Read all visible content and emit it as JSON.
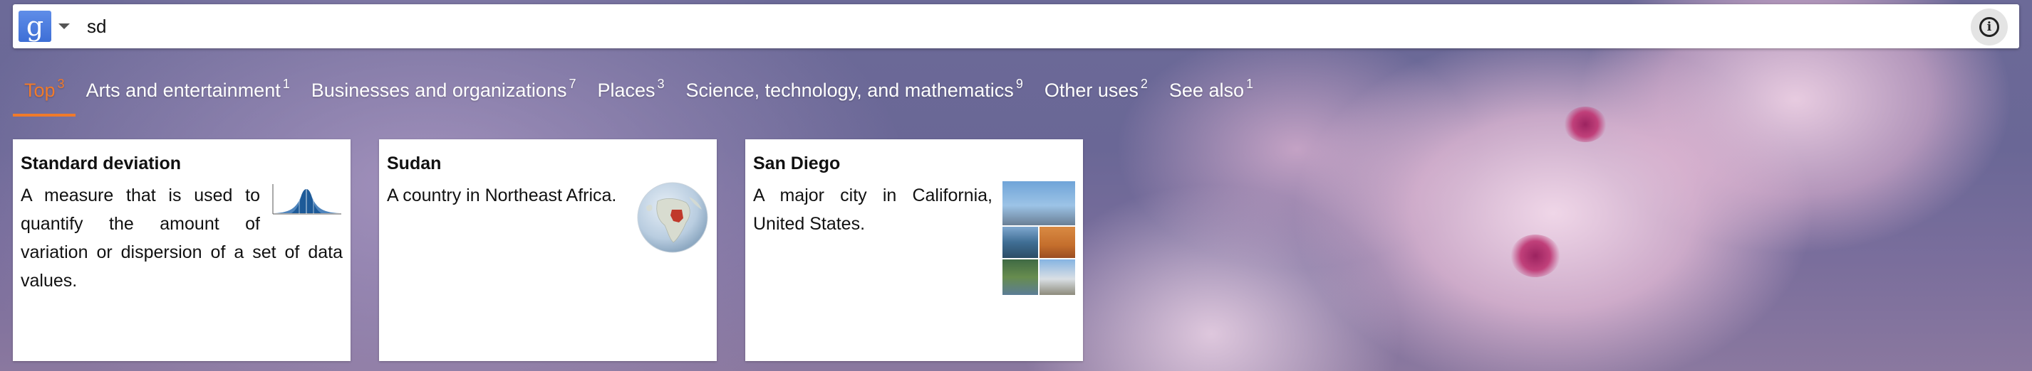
{
  "search": {
    "engine_icon": "google-g-icon",
    "engine_letter": "g",
    "query": "sd",
    "info_icon": "info-icon"
  },
  "tabs": [
    {
      "label": "Top",
      "count": "3",
      "active": true
    },
    {
      "label": "Arts and entertainment",
      "count": "1",
      "active": false
    },
    {
      "label": "Businesses and organizations",
      "count": "7",
      "active": false
    },
    {
      "label": "Places",
      "count": "3",
      "active": false
    },
    {
      "label": "Science, technology, and mathematics",
      "count": "9",
      "active": false
    },
    {
      "label": "Other uses",
      "count": "2",
      "active": false
    },
    {
      "label": "See also",
      "count": "1",
      "active": false
    }
  ],
  "cards": [
    {
      "title": "Standard deviation",
      "description": "A measure that is used to quantify the amount of variation or dispersion of a set of data values.",
      "thumbnail": "normal-distribution-chart"
    },
    {
      "title": "Sudan",
      "description": "A country in Northeast Africa.",
      "thumbnail": "globe-africa-sudan"
    },
    {
      "title": "San Diego",
      "description": "A major city in California, United States.",
      "thumbnail": "city-photo-collage"
    }
  ],
  "colors": {
    "accent_active_tab": "#f07a2b",
    "engine_blue": "#4a7ddf",
    "card_background": "#ffffff"
  }
}
